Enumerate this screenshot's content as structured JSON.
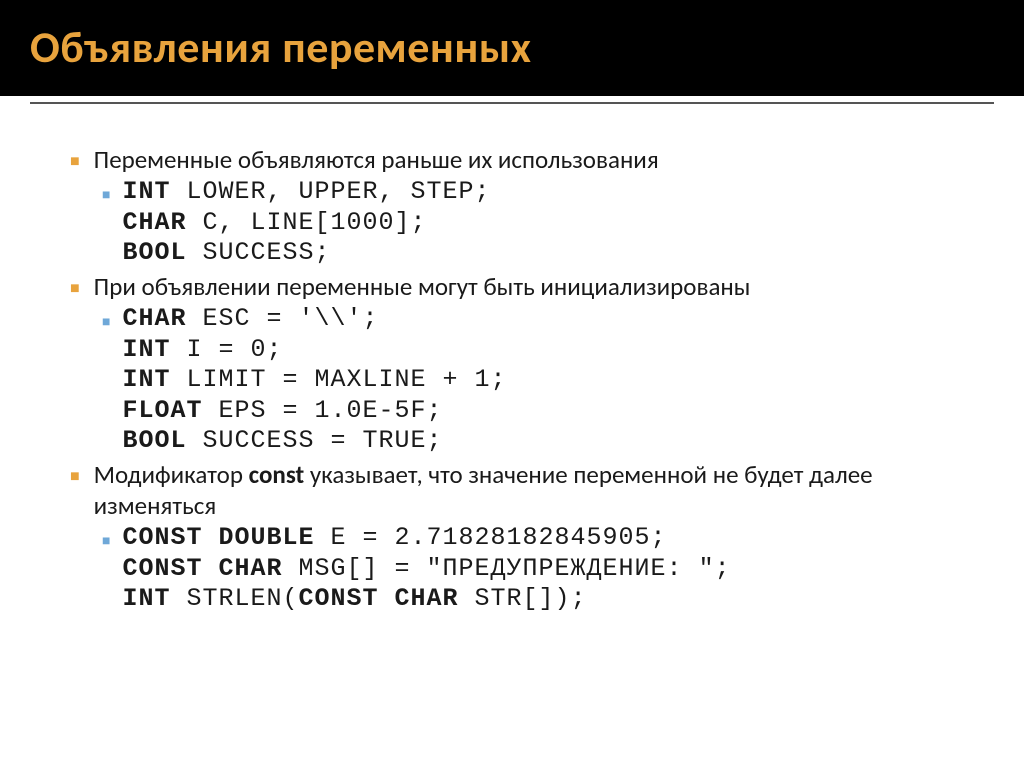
{
  "title": "Объявления переменных",
  "items": [
    {
      "text": "Переменные объявляются раньше их использования",
      "code": [
        {
          "kw": "int",
          "rest": " lower, upper, step;"
        },
        {
          "kw": "char",
          "rest": " c, line[1000];"
        },
        {
          "kw": "bool",
          "rest": " success;"
        }
      ]
    },
    {
      "text": "При объявлении переменные могут быть инициализированы",
      "code": [
        {
          "kw": "char",
          "rest": " esc = '\\\\';"
        },
        {
          "kw": "int",
          "rest": " i = 0;"
        },
        {
          "kw": "int",
          "rest": " limit = MAXLINE + 1;"
        },
        {
          "kw": "float",
          "rest": " eps = 1.0e-5f;"
        },
        {
          "kw": "bool",
          "rest": " success = true;"
        }
      ]
    },
    {
      "text_pre": "Модификатор ",
      "text_bold": "const",
      "text_post": " указывает, что значение переменной не будет далее изменяться",
      "code": [
        {
          "kw": "const double",
          "rest": " e = 2.71828182845905;"
        },
        {
          "kw": "const char",
          "rest": " msg[] = \"предупреждение: \";"
        },
        {
          "kw": "int",
          "rest": " strlen(",
          "kw2": "const char",
          "rest2": " str[]);"
        }
      ]
    }
  ]
}
